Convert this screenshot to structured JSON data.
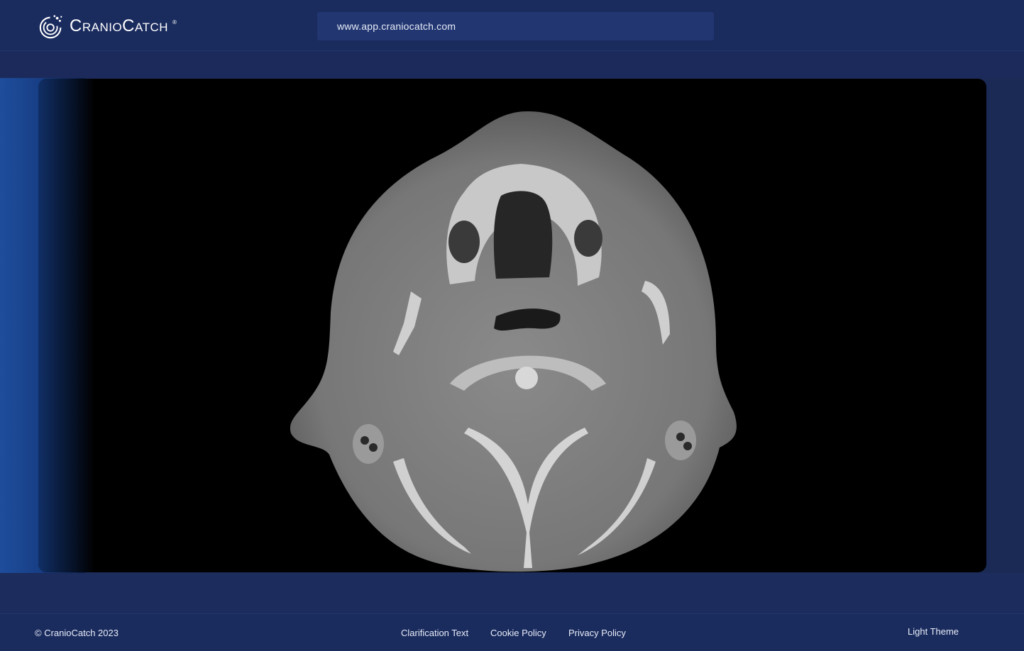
{
  "header": {
    "brand": "CranioCatch",
    "url": "www.app.craniocatch.com"
  },
  "viewer": {
    "image": "axial-ct-scan-image"
  },
  "footer": {
    "copyright": "© CranioCatch 2023",
    "links": [
      "Clarification Text",
      "Cookie Policy",
      "Privacy Policy"
    ],
    "theme_toggle": "Light Theme"
  }
}
